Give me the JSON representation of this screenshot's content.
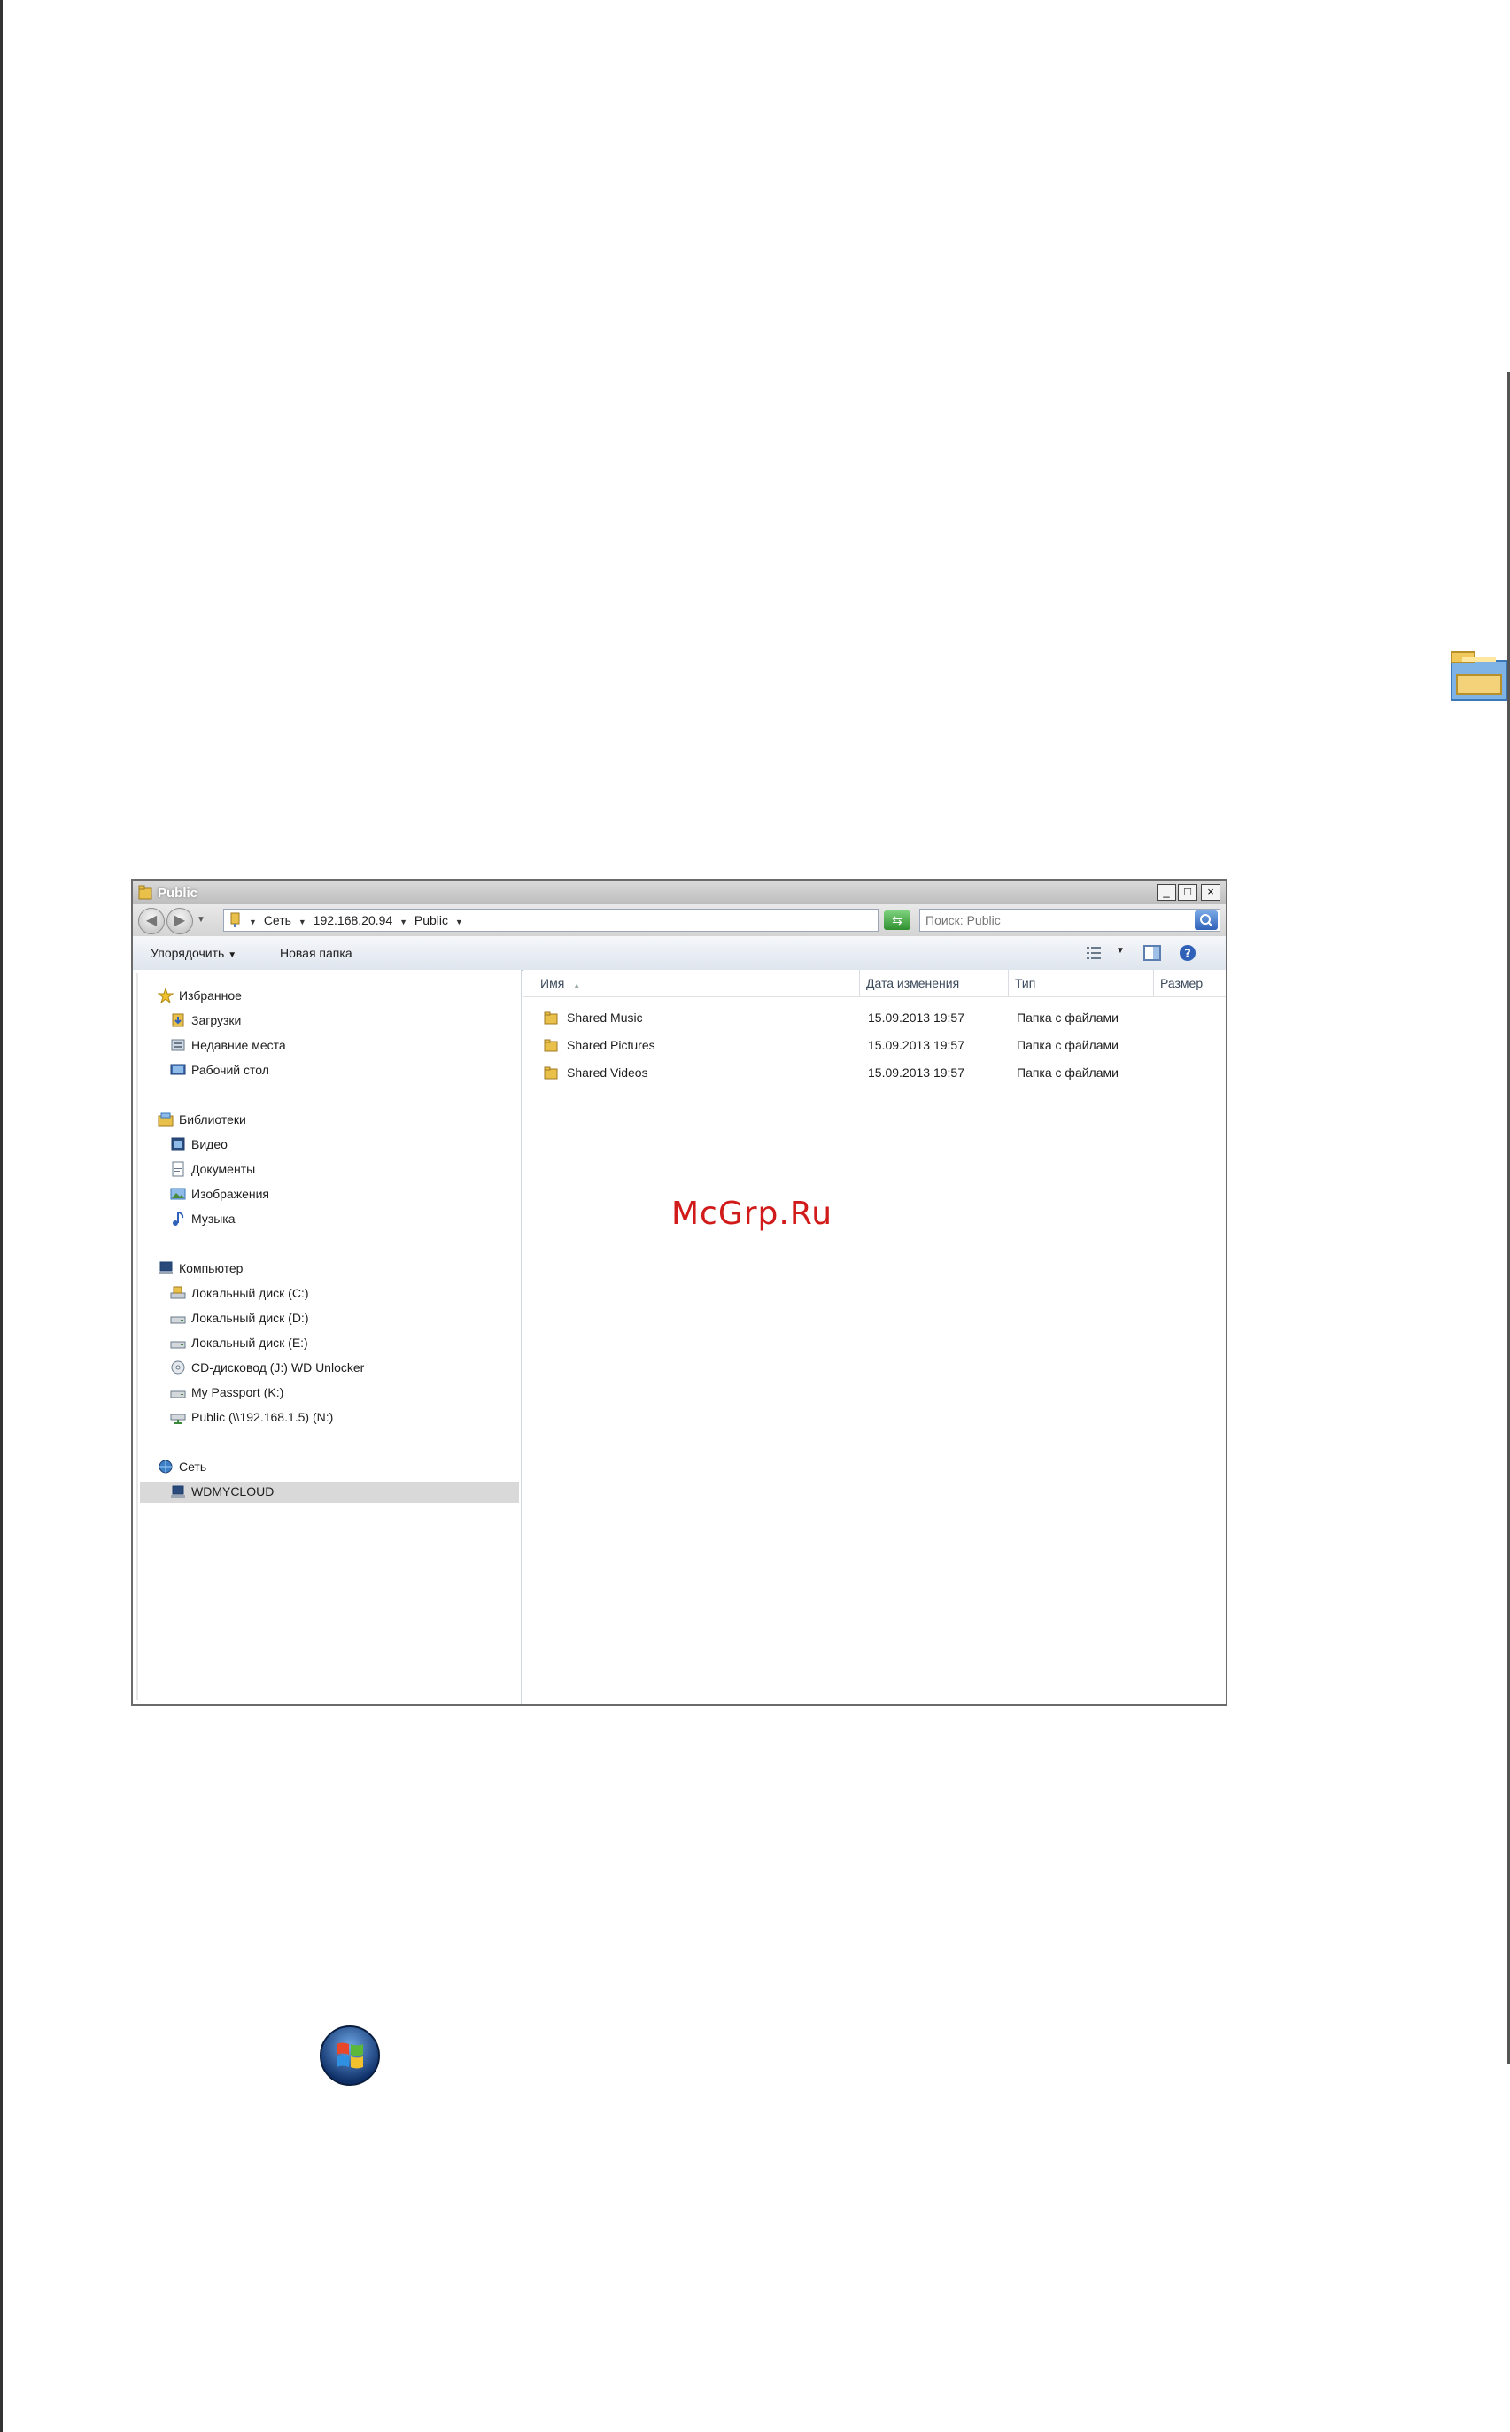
{
  "window": {
    "title": "Public",
    "controls": {
      "minimize": "_",
      "maximize": "□",
      "close": "×"
    }
  },
  "addressbar": {
    "breadcrumbs": [
      "Сеть",
      "192.168.20.94",
      "Public"
    ],
    "search_placeholder": "Поиск: Public"
  },
  "toolbar": {
    "organize_label": "Упорядочить",
    "new_folder_label": "Новая папка"
  },
  "navpane": {
    "groups": [
      {
        "label": "Избранное",
        "icon": "star-icon",
        "items": [
          {
            "label": "Загрузки",
            "icon": "downloads-icon"
          },
          {
            "label": "Недавние места",
            "icon": "recent-places-icon"
          },
          {
            "label": "Рабочий стол",
            "icon": "desktop-icon"
          }
        ]
      },
      {
        "label": "Библиотеки",
        "icon": "libraries-icon",
        "items": [
          {
            "label": "Видео",
            "icon": "video-icon"
          },
          {
            "label": "Документы",
            "icon": "documents-icon"
          },
          {
            "label": "Изображения",
            "icon": "pictures-icon"
          },
          {
            "label": "Музыка",
            "icon": "music-icon"
          }
        ]
      },
      {
        "label": "Компьютер",
        "icon": "computer-icon",
        "items": [
          {
            "label": "Локальный диск (C:)",
            "icon": "drive-icon"
          },
          {
            "label": "Локальный диск (D:)",
            "icon": "drive-icon"
          },
          {
            "label": "Локальный диск (E:)",
            "icon": "drive-icon"
          },
          {
            "label": "CD-дисковод (J:) WD Unlocker",
            "icon": "cd-drive-icon"
          },
          {
            "label": "My Passport (K:)",
            "icon": "drive-icon"
          },
          {
            "label": "Public (\\\\192.168.1.5) (N:)",
            "icon": "network-drive-icon"
          }
        ]
      },
      {
        "label": "Сеть",
        "icon": "network-icon",
        "items": [
          {
            "label": "WDMYCLOUD",
            "icon": "network-device-icon",
            "selected": true
          }
        ]
      }
    ]
  },
  "filelist": {
    "columns": [
      "Имя",
      "Дата изменения",
      "Тип",
      "Размер"
    ],
    "rows": [
      {
        "name": "Shared Music",
        "date": "15.09.2013 19:57",
        "type": "Папка с файлами"
      },
      {
        "name": "Shared Pictures",
        "date": "15.09.2013 19:57",
        "type": "Папка с файлами"
      },
      {
        "name": "Shared Videos",
        "date": "15.09.2013 19:57",
        "type": "Папка с файлами"
      }
    ]
  },
  "watermark": "McGrp.Ru",
  "colors": {
    "folder": "#e8c04a",
    "accent": "#2f61b8",
    "watermark": "#d11a1a"
  }
}
